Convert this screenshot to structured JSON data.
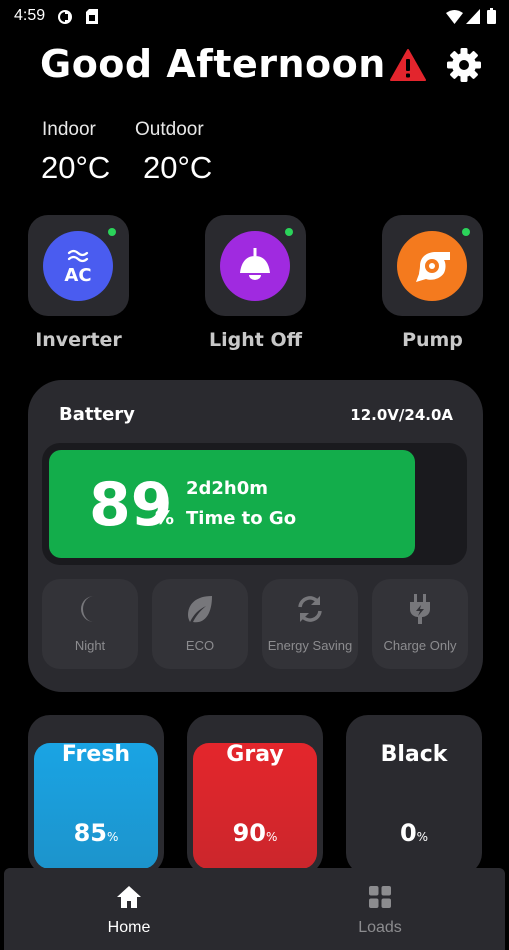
{
  "status_bar": {
    "time": "4:59"
  },
  "header": {
    "greeting": "Good Afternoon",
    "alert_icon": "warning-triangle-icon",
    "settings_icon": "gear-icon",
    "alert_color": "#e3252d"
  },
  "temperature": {
    "indoor_label": "Indoor",
    "indoor_value": "20°C",
    "outdoor_label": "Outdoor",
    "outdoor_value": "20°C"
  },
  "devices": [
    {
      "label": "Inverter",
      "icon": "ac-icon",
      "icon_text": "AC",
      "color": "#4a5cf0",
      "status_color": "#2bd35a"
    },
    {
      "label": "Light Off",
      "icon": "lamp-icon",
      "color": "#a02ae0",
      "status_color": "#2bd35a"
    },
    {
      "label": "Pump",
      "icon": "pump-icon",
      "color": "#f47a1e",
      "status_color": "#2bd35a"
    }
  ],
  "battery": {
    "title": "Battery",
    "voltage_current": "12.0V/24.0A",
    "percent": "89",
    "percent_sign": "%",
    "level_fraction": 0.89,
    "time_remaining": "2d2h0m",
    "time_label": "Time to Go",
    "fill_color": "#13ad4b"
  },
  "modes": [
    {
      "label": "Night",
      "icon": "moon-icon"
    },
    {
      "label": "ECO",
      "icon": "leaf-icon"
    },
    {
      "label": "Energy Saving",
      "icon": "refresh-icon"
    },
    {
      "label": "Charge Only",
      "icon": "plug-icon"
    }
  ],
  "tanks": [
    {
      "name": "Fresh",
      "value": "85",
      "unit": "%",
      "level_fraction": 0.85,
      "color": "#1aa4e4"
    },
    {
      "name": "Gray",
      "value": "90",
      "unit": "%",
      "level_fraction": 0.9,
      "color": "#e4262c"
    },
    {
      "name": "Black",
      "value": "0",
      "unit": "%",
      "level_fraction": 0.0,
      "color": "#2a2a2f"
    }
  ],
  "nav": {
    "home_label": "Home",
    "loads_label": "Loads",
    "active": "home"
  }
}
